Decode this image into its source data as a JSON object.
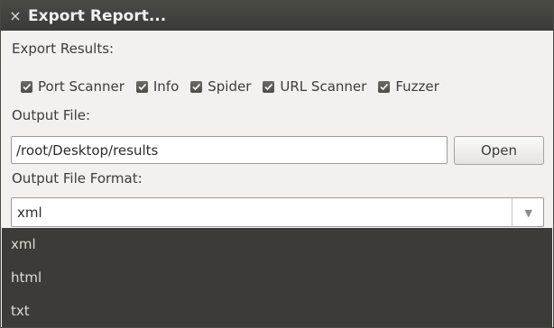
{
  "window": {
    "title": "Export Report...",
    "close_glyph": "×"
  },
  "export_results": {
    "label": "Export Results:",
    "options": [
      {
        "label": "Port Scanner",
        "checked": true
      },
      {
        "label": "Info",
        "checked": true
      },
      {
        "label": "Spider",
        "checked": true
      },
      {
        "label": "URL Scanner",
        "checked": true
      },
      {
        "label": "Fuzzer",
        "checked": true
      }
    ]
  },
  "output_file": {
    "label": "Output File:",
    "value": "/root/Desktop/results",
    "open_button": "Open"
  },
  "output_format": {
    "label": "Output File Format:",
    "selected": "xml",
    "arrow_glyph": "▼",
    "options": [
      "xml",
      "html",
      "txt"
    ]
  },
  "colors": {
    "titlebar": "#3c3b37",
    "dropdown_bg": "#3c3b37",
    "dropdown_text": "#dfdbd2",
    "window_bg": "#f2f1f0",
    "checkbox": "#5a5a55"
  }
}
